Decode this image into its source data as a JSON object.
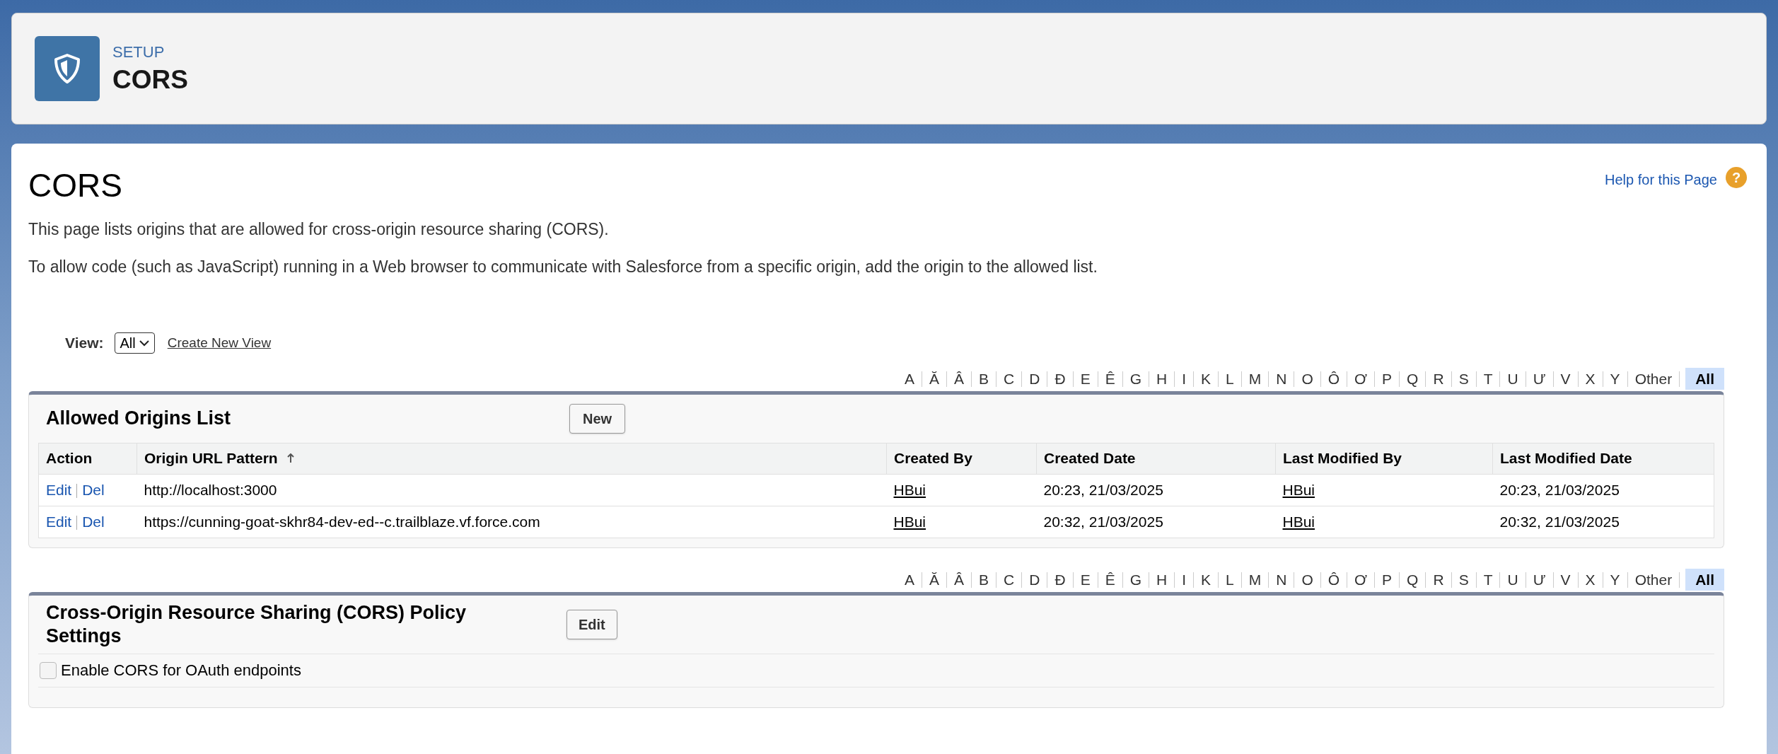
{
  "header": {
    "breadcrumb": "SETUP",
    "title": "CORS"
  },
  "page": {
    "title": "CORS",
    "help_link": "Help for this Page",
    "help_icon": "?",
    "paragraphs": [
      "This page lists origins that are allowed for cross-origin resource sharing (CORS).",
      "To allow code (such as JavaScript) running in a Web browser to communicate with Salesforce from a specific origin, add the origin to the allowed list."
    ],
    "view": {
      "label": "View:",
      "value": "All",
      "create_link": "Create New View"
    }
  },
  "alphabet_top": [
    {
      "label": "A",
      "selected": false
    },
    {
      "label": "Ă",
      "selected": false
    },
    {
      "label": "Â",
      "selected": false
    },
    {
      "label": "B",
      "selected": false
    },
    {
      "label": "C",
      "selected": false
    },
    {
      "label": "D",
      "selected": false
    },
    {
      "label": "Đ",
      "selected": false
    },
    {
      "label": "E",
      "selected": false
    },
    {
      "label": "Ê",
      "selected": false
    },
    {
      "label": "G",
      "selected": false
    },
    {
      "label": "H",
      "selected": false
    },
    {
      "label": "I",
      "selected": false
    },
    {
      "label": "K",
      "selected": false
    },
    {
      "label": "L",
      "selected": false
    },
    {
      "label": "M",
      "selected": false
    },
    {
      "label": "N",
      "selected": false
    },
    {
      "label": "O",
      "selected": false
    },
    {
      "label": "Ô",
      "selected": false
    },
    {
      "label": "Ơ",
      "selected": false
    },
    {
      "label": "P",
      "selected": false
    },
    {
      "label": "Q",
      "selected": false
    },
    {
      "label": "R",
      "selected": false
    },
    {
      "label": "S",
      "selected": false
    },
    {
      "label": "T",
      "selected": false
    },
    {
      "label": "U",
      "selected": false
    },
    {
      "label": "Ư",
      "selected": false
    },
    {
      "label": "V",
      "selected": false
    },
    {
      "label": "X",
      "selected": false
    },
    {
      "label": "Y",
      "selected": false
    },
    {
      "label": "Other",
      "selected": false
    },
    {
      "label": "All",
      "selected": true
    }
  ],
  "allowed_origins": {
    "title": "Allowed Origins List",
    "button": "New",
    "columns": [
      {
        "label": "Action",
        "sorted": false
      },
      {
        "label": "Origin URL Pattern",
        "sorted": true
      },
      {
        "label": "Created By",
        "sorted": false
      },
      {
        "label": "Created Date",
        "sorted": false
      },
      {
        "label": "Last Modified By",
        "sorted": false
      },
      {
        "label": "Last Modified Date",
        "sorted": false
      }
    ],
    "rows": [
      {
        "actions": [
          "Edit",
          "Del"
        ],
        "origin": "http://localhost:3000",
        "created_by": "HBui",
        "created_date": "20:23, 21/03/2025",
        "last_modified_by": "HBui",
        "last_modified_date": "20:23, 21/03/2025"
      },
      {
        "actions": [
          "Edit",
          "Del"
        ],
        "origin": "https://cunning-goat-skhr84-dev-ed--c.trailblaze.vf.force.com",
        "created_by": "HBui",
        "created_date": "20:32, 21/03/2025",
        "last_modified_by": "HBui",
        "last_modified_date": "20:32, 21/03/2025"
      }
    ]
  },
  "alphabet_bottom": [
    {
      "label": "A",
      "selected": false
    },
    {
      "label": "Ă",
      "selected": false
    },
    {
      "label": "Â",
      "selected": false
    },
    {
      "label": "B",
      "selected": false
    },
    {
      "label": "C",
      "selected": false
    },
    {
      "label": "D",
      "selected": false
    },
    {
      "label": "Đ",
      "selected": false
    },
    {
      "label": "E",
      "selected": false
    },
    {
      "label": "Ê",
      "selected": false
    },
    {
      "label": "G",
      "selected": false
    },
    {
      "label": "H",
      "selected": false
    },
    {
      "label": "I",
      "selected": false
    },
    {
      "label": "K",
      "selected": false
    },
    {
      "label": "L",
      "selected": false
    },
    {
      "label": "M",
      "selected": false
    },
    {
      "label": "N",
      "selected": false
    },
    {
      "label": "O",
      "selected": false
    },
    {
      "label": "Ô",
      "selected": false
    },
    {
      "label": "Ơ",
      "selected": false
    },
    {
      "label": "P",
      "selected": false
    },
    {
      "label": "Q",
      "selected": false
    },
    {
      "label": "R",
      "selected": false
    },
    {
      "label": "S",
      "selected": false
    },
    {
      "label": "T",
      "selected": false
    },
    {
      "label": "U",
      "selected": false
    },
    {
      "label": "Ư",
      "selected": false
    },
    {
      "label": "V",
      "selected": false
    },
    {
      "label": "X",
      "selected": false
    },
    {
      "label": "Y",
      "selected": false
    },
    {
      "label": "Other",
      "selected": false
    },
    {
      "label": "All",
      "selected": true
    }
  ],
  "policy": {
    "title": "Cross-Origin Resource Sharing (CORS) Policy Settings",
    "button": "Edit",
    "settings": [
      {
        "label": "Enable CORS for OAuth endpoints",
        "checked": false
      }
    ]
  }
}
